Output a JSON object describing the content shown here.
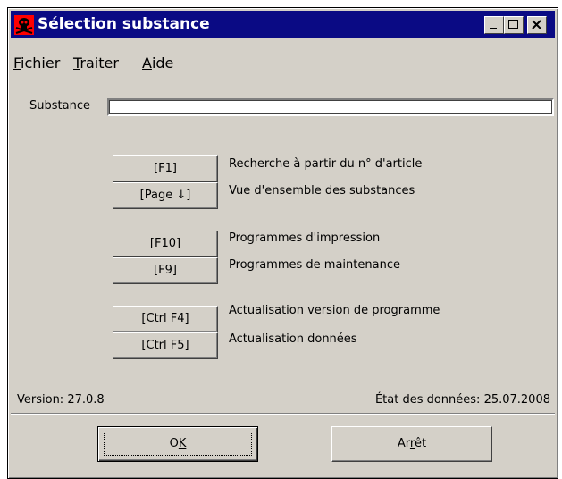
{
  "window": {
    "title": "Sélection substance",
    "title_bar_color": "#0a0a84",
    "face_color": "#d4d0c8"
  },
  "menu": [
    {
      "underline": "F",
      "rest": "ichier"
    },
    {
      "underline": "T",
      "rest": "raiter"
    },
    {
      "underline": "A",
      "rest": "ide"
    }
  ],
  "substance": {
    "label": "Substance",
    "value": ""
  },
  "functions": [
    {
      "key": "[F1]",
      "description": "Recherche à partir du n° d'article"
    },
    {
      "key": "[Page ↓]",
      "description": "Vue d'ensemble des substances"
    },
    {
      "key": "[F10]",
      "description": "Programmes d'impression"
    },
    {
      "key": "[F9]",
      "description": "Programmes de maintenance"
    },
    {
      "key": "[Ctrl F4]",
      "description": "Actualisation version de programme"
    },
    {
      "key": "[Ctrl F5]",
      "description": "Actualisation données"
    }
  ],
  "footer": {
    "version": "Version: 27.0.8",
    "data_state": "État des données: 25.07.2008"
  },
  "buttons": {
    "ok": {
      "before": "O",
      "underline": "K",
      "after": ""
    },
    "stop": {
      "before": "Ar",
      "underline": "r",
      "after": "êt"
    }
  }
}
